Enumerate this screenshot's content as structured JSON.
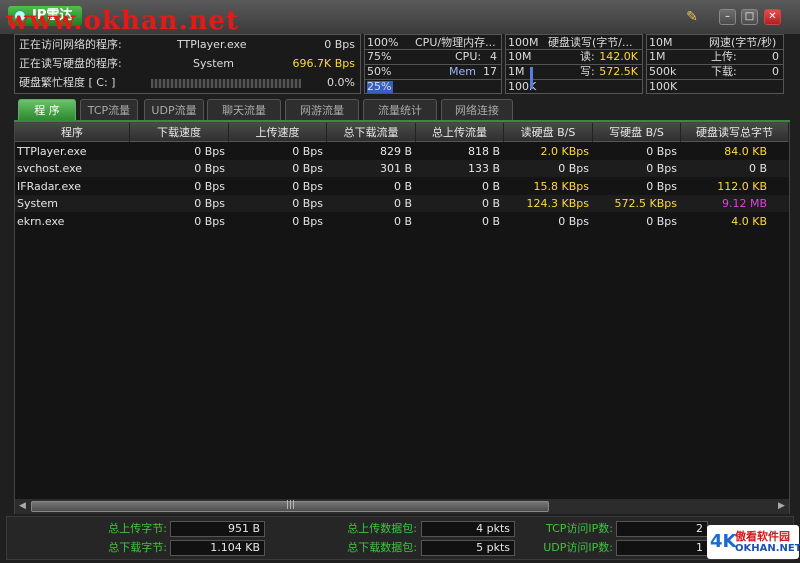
{
  "title": {
    "app_name": "IP雷达",
    "watermark": "www.okhan.net"
  },
  "info": {
    "net_label": "正在访问网络的程序:",
    "net_process": "TTPlayer.exe",
    "net_speed": "0 Bps",
    "disk_label": "正在读写硬盘的程序:",
    "disk_process": "System",
    "disk_speed": "696.7K Bps",
    "busy_label": "硬盘繁忙程度 [ C: ]",
    "busy_value": "0.0%"
  },
  "cpu_panel": {
    "r1_a": "100%",
    "r1_b": "CPU/物理内存...",
    "r2_a": "75%",
    "r2_b": "CPU:",
    "r2_c": "4",
    "r3_a": "50%",
    "r3_b": "Mem",
    "r3_c": "17",
    "r4_a": "25%"
  },
  "disk_panel": {
    "r1_a": "100M",
    "r1_b": "硬盘读写(字节/...",
    "r2_a": "10M",
    "r2_b": "读:",
    "r2_c": "142.0K",
    "r3_a": "1M",
    "r3_b": "写:",
    "r3_c": "572.5K",
    "r4_a": "100K"
  },
  "net_panel": {
    "r1_a": "10M",
    "r1_b": "网速(字节/秒)",
    "r2_a": "1M",
    "r2_b": "上传:",
    "r2_c": "0",
    "r3_a": "500k",
    "r3_b": "下载:",
    "r3_c": "0",
    "r4_a": "100K"
  },
  "tabs": [
    "程 序",
    "TCP流量",
    "UDP流量",
    "聊天流量",
    "网游流量",
    "流量统计",
    "网络连接"
  ],
  "columns": [
    "程序",
    "下载速度",
    "上传速度",
    "总下载流量",
    "总上传流量",
    "读硬盘 B/S",
    "写硬盘 B/S",
    "硬盘读写总字节"
  ],
  "rows": [
    [
      "TTPlayer.exe",
      "0 Bps",
      "0 Bps",
      "829 B",
      "818 B",
      "2.0 KBps",
      "0 Bps",
      "84.0 KB"
    ],
    [
      "svchost.exe",
      "0 Bps",
      "0 Bps",
      "301 B",
      "133 B",
      "0 Bps",
      "0 Bps",
      "0 B"
    ],
    [
      "IFRadar.exe",
      "0 Bps",
      "0 Bps",
      "0 B",
      "0 B",
      "15.8 KBps",
      "0 Bps",
      "112.0 KB"
    ],
    [
      "System",
      "0 Bps",
      "0 Bps",
      "0 B",
      "0 B",
      "124.3 KBps",
      "572.5 KBps",
      "9.12 MB"
    ],
    [
      "ekrn.exe",
      "0 Bps",
      "0 Bps",
      "0 B",
      "0 B",
      "0 Bps",
      "0 Bps",
      "4.0 KB"
    ]
  ],
  "footer": {
    "total_up_label": "总上传字节:",
    "total_up": "951 B",
    "total_down_label": "总下载字节:",
    "total_down": "1.104 KB",
    "pkt_up_label": "总上传数据包:",
    "pkt_up": "4 pkts",
    "pkt_down_label": "总下载数据包:",
    "pkt_down": "5 pkts",
    "tcp_label": "TCP访问IP数:",
    "tcp": "2",
    "udp_label": "UDP访问IP数:",
    "udp": "1"
  },
  "brand": {
    "mark": "4K",
    "line1": "傲看软件园",
    "line2": "OKHAN.NET"
  },
  "colors": {
    "accent": "#3b8a3b",
    "highlight": "#ffd83a",
    "magenta": "#e040e0"
  }
}
